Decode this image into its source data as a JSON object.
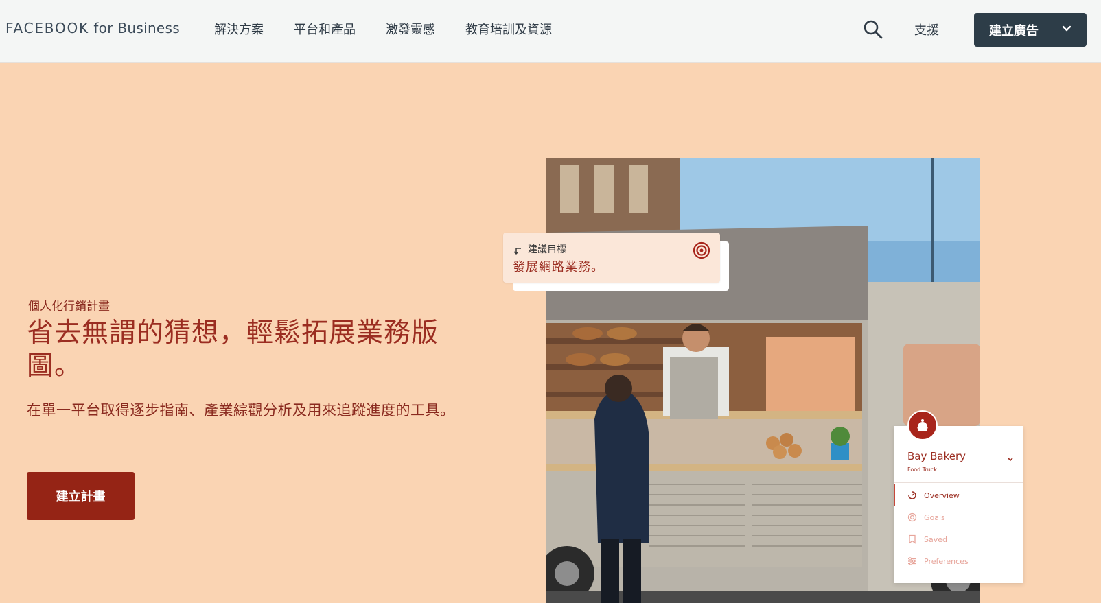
{
  "nav": {
    "brand_word": "FACEBOOK",
    "brand_suffix": "for Business",
    "links": [
      "解決方案",
      "平台和產品",
      "激發靈感",
      "教育培訓及資源"
    ],
    "search_icon": "search-icon",
    "support_label": "支援",
    "cta_label": "建立廣告"
  },
  "hero": {
    "eyebrow": "個人化行銷計畫",
    "headline": "省去無謂的猜想，輕鬆拓展業務版圖。",
    "subtext": "在單一平台取得逐步指南、產業綜觀分析及用來追蹤進度的工具。",
    "cta_label": "建立計畫"
  },
  "goal_card": {
    "label": "建議目標",
    "text": "發展網路業務。"
  },
  "business_panel": {
    "name": "Bay Bakery",
    "type": "Food Truck",
    "menu": [
      "Overview",
      "Goals",
      "Saved",
      "Preferences"
    ]
  },
  "colors": {
    "brand_red": "#952415",
    "hero_bg": "#fad4b3",
    "nav_cta_bg": "#2d3d48"
  }
}
